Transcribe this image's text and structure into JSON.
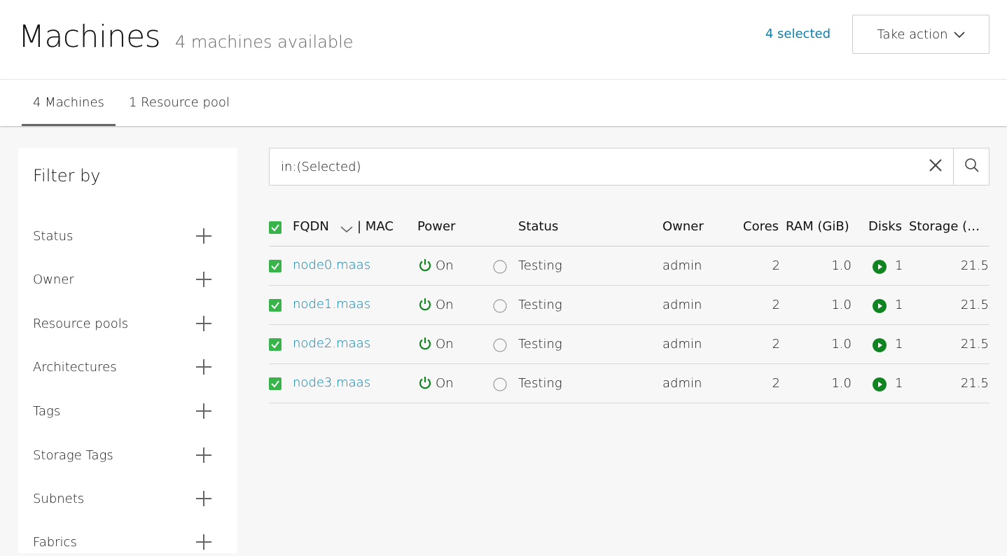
{
  "header": {
    "title": "Machines",
    "subtitle": "4 machines available",
    "selected_link": "4 selected",
    "take_action_label": "Take action",
    "colors": {
      "link": "#0e7ea8",
      "accent": "#38b44a",
      "power_on": "#0f8420"
    }
  },
  "tabs": [
    {
      "label": "4 Machines",
      "active": true
    },
    {
      "label": "1 Resource pool",
      "active": false
    }
  ],
  "filter_panel": {
    "title": "Filter by",
    "items": [
      {
        "label": "Status"
      },
      {
        "label": "Owner"
      },
      {
        "label": "Resource pools"
      },
      {
        "label": "Architectures"
      },
      {
        "label": "Tags"
      },
      {
        "label": "Storage Tags"
      },
      {
        "label": "Subnets"
      },
      {
        "label": "Fabrics"
      }
    ]
  },
  "search": {
    "value": "in:(Selected)",
    "placeholder": ""
  },
  "table": {
    "columns": {
      "fqdn": "FQDN",
      "mac": "| MAC",
      "power": "Power",
      "status": "Status",
      "owner": "Owner",
      "cores": "Cores",
      "ram": "RAM (GiB)",
      "disks": "Disks",
      "storage": "Storage (…"
    },
    "rows": [
      {
        "fqdn": "node0.maas",
        "power": "On",
        "status": "Testing",
        "owner": "admin",
        "cores": "2",
        "ram": "1.0",
        "disks": "1",
        "storage": "21.5"
      },
      {
        "fqdn": "node1.maas",
        "power": "On",
        "status": "Testing",
        "owner": "admin",
        "cores": "2",
        "ram": "1.0",
        "disks": "1",
        "storage": "21.5"
      },
      {
        "fqdn": "node2.maas",
        "power": "On",
        "status": "Testing",
        "owner": "admin",
        "cores": "2",
        "ram": "1.0",
        "disks": "1",
        "storage": "21.5"
      },
      {
        "fqdn": "node3.maas",
        "power": "On",
        "status": "Testing",
        "owner": "admin",
        "cores": "2",
        "ram": "1.0",
        "disks": "1",
        "storage": "21.5"
      }
    ]
  }
}
